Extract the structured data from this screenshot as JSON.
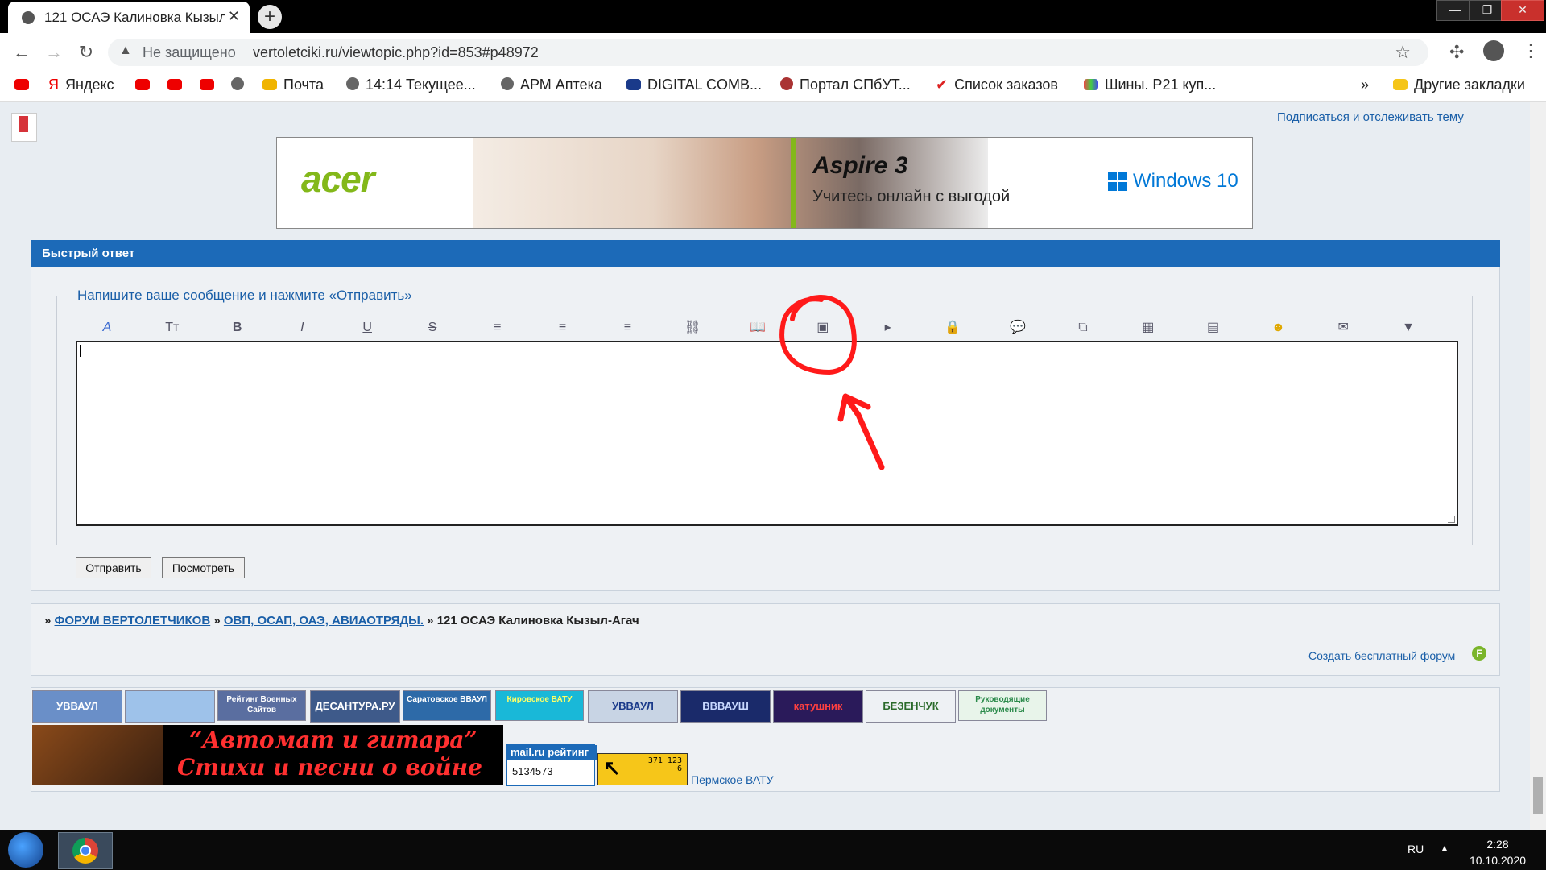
{
  "browser": {
    "tab_title": "121 ОСАЭ Калиновка Кызыл-Агач",
    "tab_close": "✕",
    "new_tab": "+",
    "not_secure": "Не защищено",
    "url": "vertoletciki.ru/viewtopic.php?id=853#p48972",
    "window_buttons": {
      "minimize": "—",
      "maximize": "❐",
      "close": "✕"
    },
    "bookmarks": [
      "Яндекс",
      "Почта",
      "14:14 Текущее...",
      "АРМ Аптека",
      "DIGITAL COMB...",
      "Портал СПбУТ...",
      "Список заказов",
      "Шины. P21 куп..."
    ],
    "more_bookmarks": "»",
    "other_bookmarks": "Другие закладки"
  },
  "page": {
    "subscribe_link": "Подписаться и отслеживать тему",
    "ad": {
      "brand": "acer",
      "product": "Aspire 3",
      "tagline": "Учитесь онлайн с выгодой",
      "os": "Windows 10"
    },
    "quick_reply": {
      "title": "Быстрый ответ",
      "legend": "Напишите ваше сообщение и нажмите «Отправить»",
      "toolbar": [
        {
          "name": "font-color-icon",
          "glyph": "A"
        },
        {
          "name": "font-size-icon",
          "glyph": "Tт"
        },
        {
          "name": "bold-icon",
          "glyph": "B"
        },
        {
          "name": "italic-icon",
          "glyph": "I"
        },
        {
          "name": "underline-icon",
          "glyph": "U"
        },
        {
          "name": "strikethrough-icon",
          "glyph": "S"
        },
        {
          "name": "align-left-icon",
          "glyph": "≡"
        },
        {
          "name": "align-center-icon",
          "glyph": "≡"
        },
        {
          "name": "align-right-icon",
          "glyph": "≡"
        },
        {
          "name": "link-icon",
          "glyph": "⛓"
        },
        {
          "name": "book-icon",
          "glyph": "📖"
        },
        {
          "name": "image-icon",
          "glyph": "▣"
        },
        {
          "name": "video-icon",
          "glyph": "▸"
        },
        {
          "name": "lock-icon",
          "glyph": "🔒"
        },
        {
          "name": "quote-icon",
          "glyph": "💬"
        },
        {
          "name": "code-icon",
          "glyph": "⧉"
        },
        {
          "name": "color-palette-icon",
          "glyph": "▦"
        },
        {
          "name": "table-icon",
          "glyph": "▤"
        },
        {
          "name": "smiley-icon",
          "glyph": "☻"
        },
        {
          "name": "mail-icon",
          "glyph": "✉"
        },
        {
          "name": "more-dropdown-icon",
          "glyph": "▼"
        }
      ],
      "submit_label": "Отправить",
      "preview_label": "Посмотреть"
    },
    "breadcrumbs": {
      "sep": "»",
      "forum": "ФОРУМ ВЕРТОЛЕТЧИКОВ",
      "section": "ОВП, ОСАП, ОАЭ, АВИАОТРЯДЫ.",
      "topic": "121 ОСАЭ Калиновка Кызыл-Агач"
    },
    "free_forum_link": "Создать бесплатный форум",
    "free_forum_icon": "F",
    "banners": [
      {
        "name": "uvvaul-banner",
        "text": "УВВАУЛ",
        "bg": "#6a8fc8",
        "fg": "#ffffff"
      },
      {
        "name": "aircraft-banner",
        "text": "",
        "bg": "#9ec2ea",
        "fg": "#ffffff"
      },
      {
        "name": "rating-banner",
        "text": "Рейтинг Военных Сайтов",
        "bg": "#5a6ea0",
        "fg": "#ffffff"
      },
      {
        "name": "desantura-banner",
        "text": "ДЕСАНТУРА.РУ",
        "bg": "#3e5a8a",
        "fg": "#ffffff"
      },
      {
        "name": "saratov-banner",
        "text": "Саратовское ВВАУЛ",
        "bg": "#2d6aa8",
        "fg": "#ffffff"
      },
      {
        "name": "kirov-banner",
        "text": "Кировское ВАТУ",
        "bg": "#19b8d8",
        "fg": "#ffff66"
      },
      {
        "name": "uvvaul-2-banner",
        "text": "УВВАУЛ",
        "bg": "#c8d4e4",
        "fg": "#1a3a8a"
      },
      {
        "name": "vvvaush-banner",
        "text": "ВВВАУШ",
        "bg": "#1a2a6a",
        "fg": "#c8d8ff"
      },
      {
        "name": "katushnik-banner",
        "text": "катушник",
        "bg": "#2a1a5a",
        "fg": "#ff4040"
      },
      {
        "name": "bezenchuk-banner",
        "text": "БЕЗЕНЧУК",
        "bg": "#eef1f4",
        "fg": "#2a6a2a"
      },
      {
        "name": "docs-banner",
        "text": "Руководящие документы",
        "bg": "#e8f4ea",
        "fg": "#2a8a4a"
      }
    ],
    "gitar": {
      "line1": "“Автомат и гитара”",
      "line2": "Стихи и песни о войне"
    },
    "mailru": {
      "label": "mail.ru рейтинг",
      "count": "5134573"
    },
    "yellow_counter": {
      "arrow": "↖",
      "numbers": "371 123 6"
    },
    "perm_link": "Пермское ВАТУ"
  },
  "taskbar": {
    "lang": "RU",
    "up_arrow": "▲",
    "time": "2:28",
    "date": "10.10.2020"
  },
  "annotation_color": "#ff1a1a"
}
